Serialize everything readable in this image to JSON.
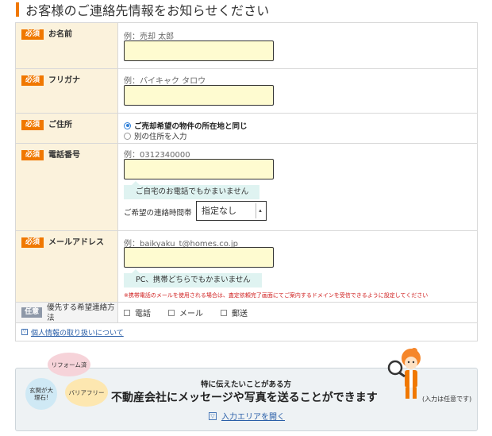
{
  "page": {
    "title": "お客様のご連絡先情報をお知らせください"
  },
  "badges": {
    "required": "必須",
    "optional": "任意"
  },
  "name": {
    "label": "お名前",
    "example": "例：売却 太郎",
    "value": ""
  },
  "furigana": {
    "label": "フリガナ",
    "example": "例：バイキャク タロウ",
    "value": ""
  },
  "address": {
    "label": "ご住所",
    "options": [
      "ご売却希望の物件の所在地と同じ",
      "別の住所を入力"
    ],
    "selected_index": 0
  },
  "phone": {
    "label": "電話番号",
    "example": "例：0312340000",
    "value": "",
    "hint": "ご自宅のお電話でもかまいません",
    "contact_time_label": "ご希望の連絡時間帯",
    "contact_time_selected": "指定なし"
  },
  "email": {
    "label": "メールアドレス",
    "example": "例：baikyaku_t@homes.co.jp",
    "value": "",
    "hint": "PC、携帯どちらでもかまいません",
    "note": "※携帯電話のメールを使用される場合は、査定依頼完了画面にてご案内するドメインを受信できるように設定してください"
  },
  "preferred_contact": {
    "label": "優先する希望連絡方法",
    "options": [
      "電話",
      "メール",
      "郵送"
    ]
  },
  "privacy": {
    "toggle_glyph": "▽",
    "link": "個人情報の取り扱いについて"
  },
  "message_area": {
    "bubbles": [
      "リフォーム済",
      "玄関が大理石!",
      "バリアフリー"
    ],
    "lead": "特に伝えたいことがある方",
    "headline": "不動産会社にメッセージや写真を送ることができます",
    "note": "(入力は任意です)",
    "open_link": "入力エリアを開く",
    "colors": {
      "bubble_pink": "#f6d3d9",
      "bubble_blue": "#cfe9f5",
      "bubble_yellow": "#fde7b0"
    }
  },
  "colors": {
    "accent": "#f07800",
    "label_bg": "#fbf2dc",
    "input_bg": "#fefbd0",
    "hint_bg": "#dff3f1"
  }
}
